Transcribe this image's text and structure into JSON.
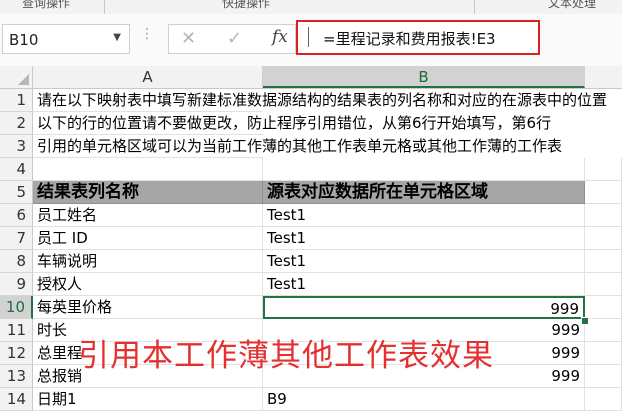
{
  "ribbon": {
    "groups": [
      "查询操作",
      "快捷操作",
      "文本处理"
    ]
  },
  "formula_bar": {
    "name_box": "B10",
    "cancel_icon": "close-icon",
    "enter_icon": "check-icon",
    "fx_label": "fx",
    "formula": "=里程记录和费用报表!E3"
  },
  "sheet": {
    "columns": [
      "A",
      "B"
    ],
    "active_column": "B",
    "active_row": "10",
    "rows": [
      {
        "num": "1",
        "a": "请在以下映射表中填写新建标准数据源结构的结果表的列名称和对应的在源表中的位置",
        "b": ""
      },
      {
        "num": "2",
        "a": "以下的行的位置请不要做更改，防止程序引用错位，从第6行开始填写，第6行",
        "b": ""
      },
      {
        "num": "3",
        "a": "引用的单元格区域可以为当前工作薄的其他工作表单元格或其他工作薄的工作表",
        "b": ""
      },
      {
        "num": "4",
        "a": "",
        "b": ""
      },
      {
        "num": "5",
        "a": "结果表列名称",
        "b": "源表对应数据所在单元格区域"
      },
      {
        "num": "6",
        "a": "员工姓名",
        "b": "Test1"
      },
      {
        "num": "7",
        "a": "员工 ID",
        "b": "Test1"
      },
      {
        "num": "8",
        "a": "车辆说明",
        "b": "Test1"
      },
      {
        "num": "9",
        "a": "授权人",
        "b": "Test1"
      },
      {
        "num": "10",
        "a": "每英里价格",
        "b": "999"
      },
      {
        "num": "11",
        "a": "时长",
        "b": "999"
      },
      {
        "num": "12",
        "a": "总里程",
        "b": "999"
      },
      {
        "num": "13",
        "a": "总报销",
        "b": "999"
      },
      {
        "num": "14",
        "a": "日期1",
        "b": "B9"
      }
    ]
  },
  "overlay_caption": "引用本工作薄其他工作表效果",
  "colors": {
    "accent_green": "#217346",
    "highlight_red": "#e02020",
    "header_fill": "#a6a6a6"
  }
}
